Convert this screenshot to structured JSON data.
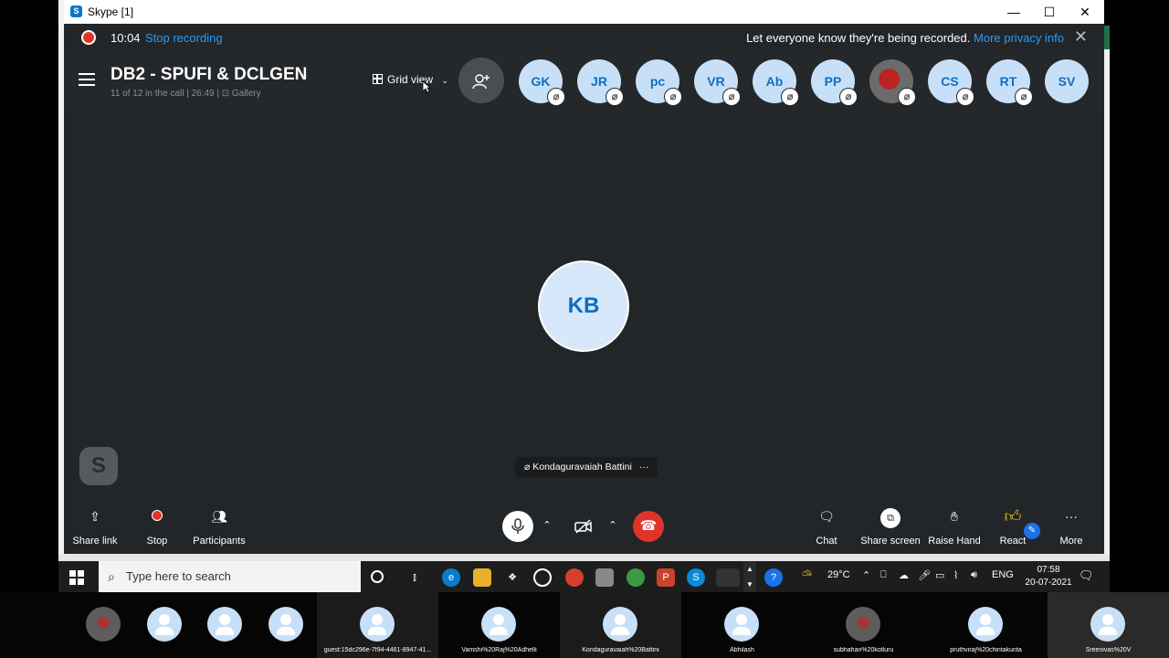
{
  "window": {
    "title": "Skype [1]"
  },
  "recording": {
    "time": "10:04",
    "stop_label": "Stop recording",
    "notice": "Let everyone know they're being recorded.",
    "privacy_link": "More privacy info"
  },
  "call": {
    "title": "DB2 - SPUFI & DCLGEN",
    "subtitle": "11 of 12 in the call | 26:49 | ⊡ Gallery",
    "view_label": "Grid view",
    "participants": [
      {
        "initials": "GK"
      },
      {
        "initials": "JR"
      },
      {
        "initials": "pc"
      },
      {
        "initials": "VR"
      },
      {
        "initials": "Ab"
      },
      {
        "initials": "PP"
      },
      {
        "initials": ""
      },
      {
        "initials": "CS"
      },
      {
        "initials": "RT"
      },
      {
        "initials": "SV"
      }
    ],
    "speaker_initials": "KB",
    "speaker_name": "Kondaguravaiah Battini",
    "skype_mini": "S"
  },
  "controls": {
    "share_link": "Share link",
    "stop": "Stop",
    "participants": "Participants",
    "chat": "Chat",
    "share_screen": "Share screen",
    "raise_hand": "Raise Hand",
    "react": "React",
    "more": "More"
  },
  "taskbar": {
    "search_placeholder": "Type here to search",
    "weather": "29°C",
    "lang": "ENG",
    "time": "07:58",
    "date": "20-07-2021"
  },
  "strip": {
    "tiles": [
      {
        "caption": "guest:15dc296e-7f94-4461-8947-41..."
      },
      {
        "caption": "Vamshi%20Raj%20Adhelli"
      },
      {
        "caption": "Kondaguravaiah%20Battini"
      },
      {
        "caption": "Abhilash"
      },
      {
        "caption": "subhahan%20kotluru"
      },
      {
        "caption": "pruthviraj%20chintakunta"
      },
      {
        "caption": "Sreenivas%20V"
      }
    ]
  }
}
